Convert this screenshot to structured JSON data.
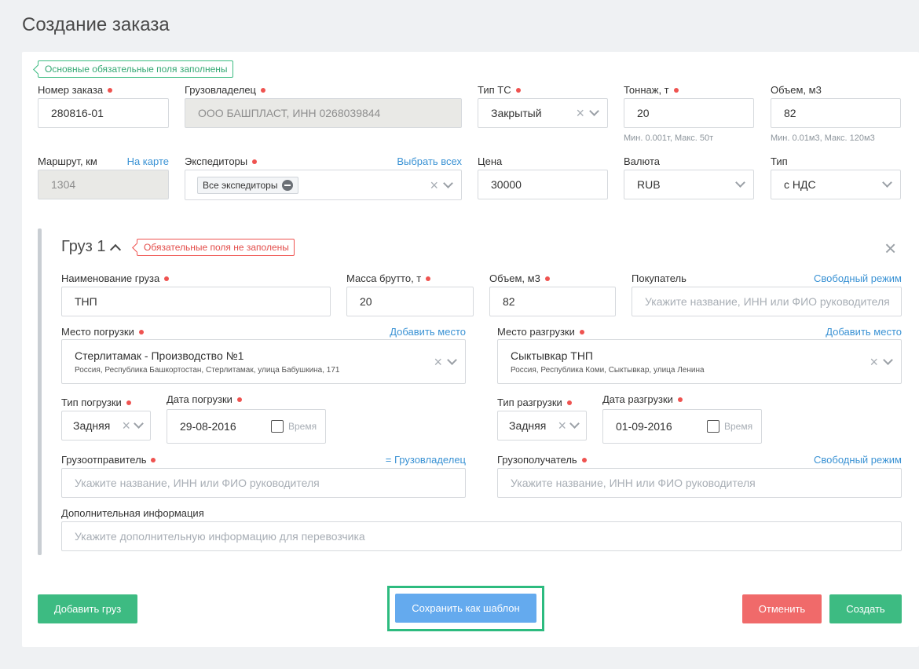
{
  "page_title": "Создание заказа",
  "status_ok": "Основные обязательные поля заполнены",
  "order": {
    "number_label": "Номер заказа",
    "number": "280816-01",
    "owner_label": "Грузовладелец",
    "owner": "ООО БАШПЛАСТ, ИНН 0268039844",
    "vehicle_label": "Тип ТС",
    "vehicle": "Закрытый",
    "tonnage_label": "Тоннаж, т",
    "tonnage": "20",
    "tonnage_hint": "Мин. 0.001т, Макс. 50т",
    "volume_label": "Объем, м3",
    "volume": "82",
    "volume_hint": "Мин. 0.01м3, Макс. 120м3",
    "route_label": "Маршрут, км",
    "route_link": "На карте",
    "route": "1304",
    "forwarders_label": "Экспедиторы",
    "forwarders_link": "Выбрать всех",
    "forwarders_tag": "Все экспедиторы",
    "price_label": "Цена",
    "price": "30000",
    "currency_label": "Валюта",
    "currency": "RUB",
    "type_label": "Тип",
    "type": "с НДС"
  },
  "cargo": {
    "title": "Груз 1",
    "status_err": "Обязательные поля не заполены",
    "name_label": "Наименование груза",
    "name": "ТНП",
    "gross_label": "Масса брутто, т",
    "gross": "20",
    "volume_label": "Объем, м3",
    "volume": "82",
    "buyer_label": "Покупатель",
    "buyer_link": "Свободный режим",
    "buyer_placeholder": "Укажите название, ИНН или ФИО руководителя",
    "load_place_label": "Место погрузки",
    "load_place_link": "Добавить место",
    "load_place": "Стерлитамак - Производство №1",
    "load_place_addr": "Россия, Республика Башкортостан, Стерлитамак, улица Бабушкина, 171",
    "unload_place_label": "Место разгрузки",
    "unload_place_link": "Добавить место",
    "unload_place": "Сыктывкар ТНП",
    "unload_place_addr": "Россия, Республика Коми, Сыктывкар, улица Ленина",
    "load_type_label": "Тип погрузки",
    "load_type": "Задняя",
    "load_date_label": "Дата погрузки",
    "load_date": "29-08-2016",
    "unload_type_label": "Тип разгрузки",
    "unload_type": "Задняя",
    "unload_date_label": "Дата разгрузки",
    "unload_date": "01-09-2016",
    "time_label": "Время",
    "shipper_label": "Грузоотправитель",
    "shipper_link": "= Грузовладелец",
    "shipper_placeholder": "Укажите название, ИНН или ФИО руководителя",
    "consignee_label": "Грузополучатель",
    "consignee_link": "Свободный режим",
    "consignee_placeholder": "Укажите название, ИНН или ФИО руководителя",
    "info_label": "Дополнительная информация",
    "info_placeholder": "Укажите дополнительную информацию для перевозчика"
  },
  "buttons": {
    "add_cargo": "Добавить груз",
    "save_template": "Сохранить как шаблон",
    "cancel": "Отменить",
    "create": "Создать"
  },
  "colors": {
    "accent_green": "#3dbb82",
    "accent_blue": "#64aaee",
    "danger": "#f06a6a",
    "link": "#3a92d4"
  }
}
